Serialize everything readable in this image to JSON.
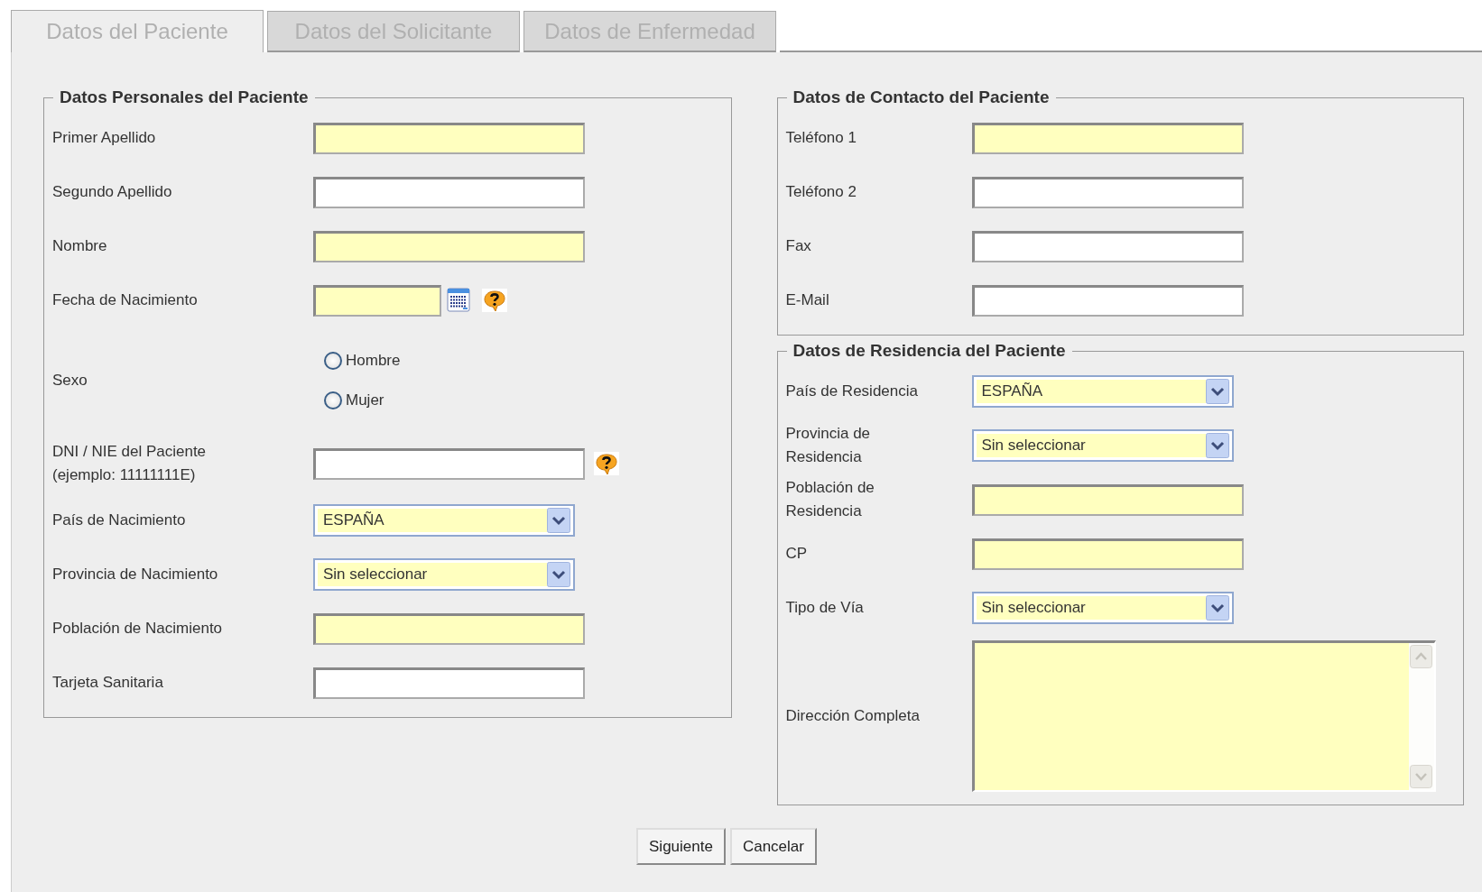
{
  "tabs": [
    {
      "label": "Datos del Paciente",
      "selected": true
    },
    {
      "label": "Datos del Solicitante",
      "selected": false
    },
    {
      "label": "Datos de Enfermedad",
      "selected": false
    }
  ],
  "left_column": {
    "sections": [
      {
        "legend": "Datos Personales del Paciente",
        "rows": [
          {
            "label": "Primer Apellido",
            "kind": "text",
            "required": true
          },
          {
            "label": "Segundo Apellido",
            "kind": "text",
            "required": false
          },
          {
            "label": "Nombre",
            "kind": "text",
            "required": true
          },
          {
            "label": "Fecha de Nacimiento",
            "kind": "date",
            "required": true,
            "help": true
          },
          {
            "label": "Sexo",
            "kind": "radio",
            "options": [
              {
                "label": "Hombre",
                "selected": false
              },
              {
                "label": "Mujer",
                "selected": false
              }
            ]
          },
          {
            "label": "DNI / NIE del Paciente\n(ejemplo: 11111111E)",
            "kind": "text",
            "required": false,
            "help": true
          },
          {
            "label": "País de Nacimiento",
            "kind": "select",
            "value": "ESPAÑA",
            "required": true
          },
          {
            "label": "Provincia de Nacimiento",
            "kind": "select",
            "value": "Sin seleccionar",
            "required": true
          },
          {
            "label": "Población de Nacimiento",
            "kind": "text",
            "required": true
          },
          {
            "label": "Tarjeta Sanitaria",
            "kind": "text",
            "required": false
          }
        ]
      }
    ]
  },
  "right_column": {
    "sections": [
      {
        "legend": "Datos de Contacto del Paciente",
        "rows": [
          {
            "label": "Teléfono 1",
            "kind": "text",
            "required": true
          },
          {
            "label": "Teléfono 2",
            "kind": "text",
            "required": false
          },
          {
            "label": "Fax",
            "kind": "text",
            "required": false
          },
          {
            "label": "E-Mail",
            "kind": "text",
            "required": false
          }
        ]
      },
      {
        "legend": "Datos de Residencia del Paciente",
        "rows": [
          {
            "label": "País de Residencia",
            "kind": "select",
            "value": "ESPAÑA",
            "required": true
          },
          {
            "label": "Provincia de Residencia",
            "kind": "select",
            "value": "Sin seleccionar",
            "required": true
          },
          {
            "label": "Población de Residencia",
            "kind": "text",
            "required": true
          },
          {
            "label": "CP",
            "kind": "text",
            "required": true
          },
          {
            "label": "Tipo de Vía",
            "kind": "select",
            "value": "Sin seleccionar",
            "required": true
          },
          {
            "label": "Dirección Completa",
            "kind": "textarea",
            "required": true
          }
        ]
      }
    ]
  },
  "buttons": [
    "Siguiente",
    "Cancelar"
  ]
}
